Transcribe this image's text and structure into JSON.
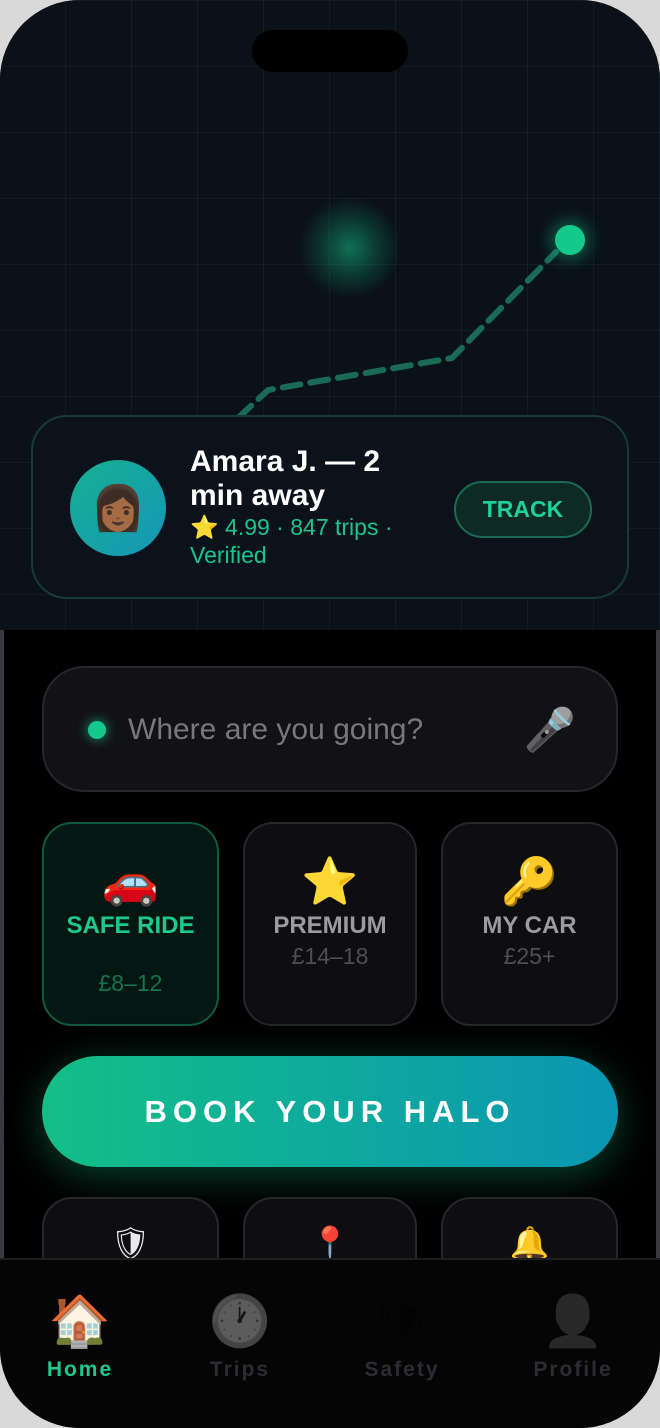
{
  "driver": {
    "avatar_emoji": "👩🏾",
    "name_line": "Amara J. — 2 min away",
    "meta_line": "⭐ 4.99 · 847 trips · Verified",
    "track_label": "TRACK"
  },
  "search": {
    "placeholder": "Where are you going?",
    "mic_icon": "🎤"
  },
  "ride_options": [
    {
      "icon": "🚗",
      "title": "SAFE RIDE",
      "price": "£8–12",
      "selected": true
    },
    {
      "icon": "⭐",
      "title": "PREMIUM",
      "price": "£14–18",
      "selected": false
    },
    {
      "icon": "🔑",
      "title": "MY CAR",
      "price": "£25+",
      "selected": false
    }
  ],
  "book_label": "BOOK YOUR HALO",
  "quick_actions": [
    {
      "icon": "🛡"
    },
    {
      "icon": "📍"
    },
    {
      "icon": "🔔"
    }
  ],
  "tabs": [
    {
      "icon": "🏠",
      "label": "Home",
      "active": true
    },
    {
      "icon": "🕐",
      "label": "Trips",
      "active": false
    },
    {
      "icon": "🛡",
      "label": "Safety",
      "active": false
    },
    {
      "icon": "👤",
      "label": "Profile",
      "active": false
    }
  ],
  "colors": {
    "accent": "#19c58a",
    "gradient_start": "#13bf86",
    "gradient_end": "#0a96b3",
    "map_bg": "#0a1119",
    "panel_bg": "#000000"
  }
}
